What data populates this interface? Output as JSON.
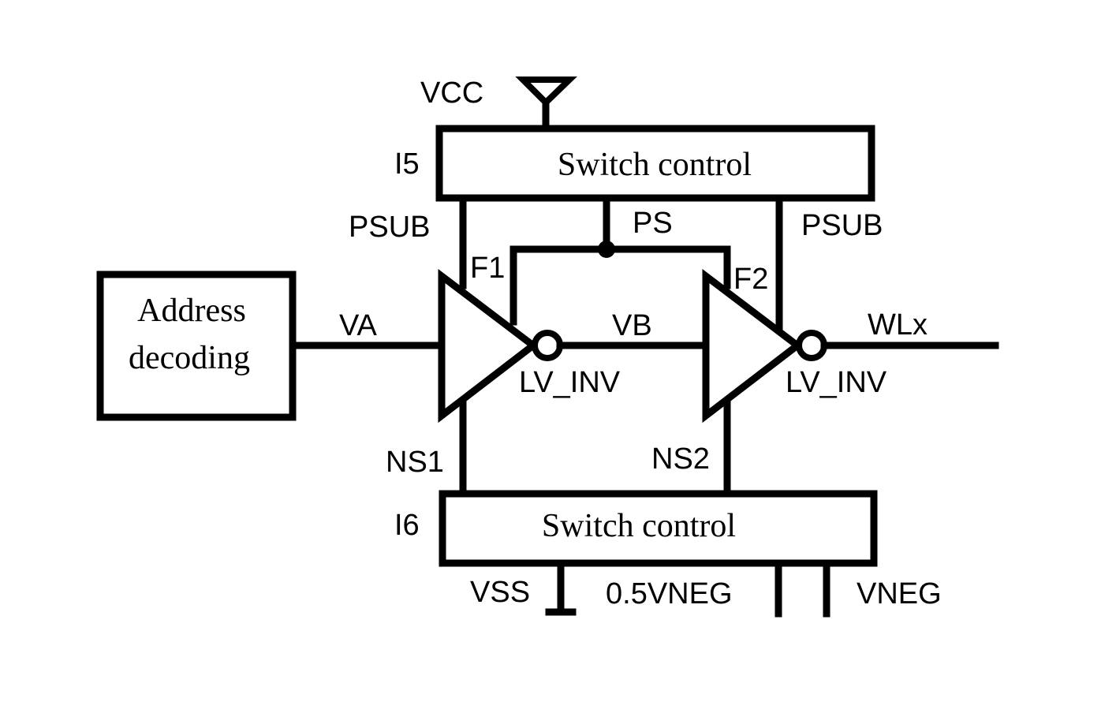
{
  "diagram": {
    "type": "circuit schematic",
    "blocks": {
      "address_decoder": {
        "line1": "Address",
        "line2": "decoding"
      },
      "switch_top": {
        "label": "Switch control",
        "ref": "I5"
      },
      "switch_bottom": {
        "label": "Switch control",
        "ref": "I6"
      }
    },
    "inverters": [
      {
        "label": "LV_INV",
        "pin": "F1"
      },
      {
        "label": "LV_INV",
        "pin": "F2"
      }
    ],
    "nets": {
      "vcc": "VCC",
      "va": "VA",
      "vb": "VB",
      "wlx": "WLx",
      "ps": "PS",
      "psub_left": "PSUB",
      "psub_right": "PSUB",
      "ns1": "NS1",
      "ns2": "NS2",
      "vss": "VSS",
      "half_vneg": "0.5VNEG",
      "vneg": "VNEG"
    },
    "colors": {
      "ink": "#000000",
      "background": "#ffffff"
    }
  }
}
